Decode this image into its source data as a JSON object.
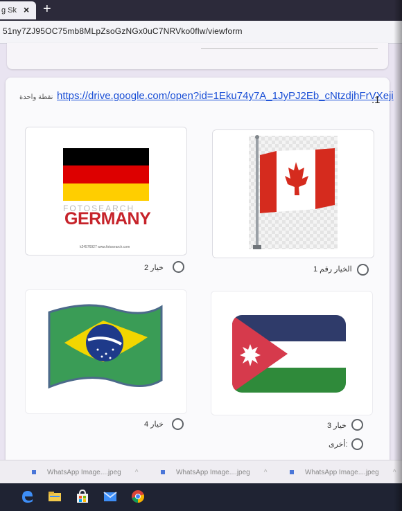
{
  "browser": {
    "tab_title": "g Sk",
    "tab_close": "×",
    "new_tab": "+",
    "url": "51ny7ZJ95OC75mb8MLpZsoGzNGx0uC7NRVko0flw/viewform"
  },
  "question": {
    "number": ".1",
    "link_text": "https://drive.google.com/open?id=1Eku74y7A_1JyPJ2Eb_cNtzdjhFrVXeji",
    "points": "نقطة واحدة"
  },
  "options": [
    {
      "label": "الخيار رقم 1",
      "image": "canada-flag"
    },
    {
      "label": "خيار 2",
      "image": "germany-flag"
    },
    {
      "label": "خيار 3",
      "image": "jordan-flag"
    },
    {
      "label": "خيار 4",
      "image": "brazil-flag"
    },
    {
      "label": "أخرى:",
      "image": ""
    }
  ],
  "germany_image": {
    "brand": "FOTOSEARCH",
    "word": "GERMANY",
    "credit": "k24576927 www.fotosearch.com"
  },
  "downloads": [
    {
      "name": "WhatsApp Image....jpeg"
    },
    {
      "name": "WhatsApp Image....jpeg"
    },
    {
      "name": "WhatsApp Image....jpeg"
    }
  ],
  "taskbar_icons": [
    "edge-icon",
    "file-explorer-icon",
    "store-icon",
    "mail-icon",
    "chrome-icon"
  ],
  "colors": {
    "link": "#1a4fd6",
    "canada_red": "#d52b1e",
    "germany_black": "#000000",
    "germany_red": "#dd0000",
    "germany_gold": "#ffce00",
    "brazil_green": "#3a9c56",
    "brazil_yellow": "#f2d600",
    "brazil_blue": "#1e3a8a",
    "jordan_black": "#2f3b6a",
    "jordan_green": "#2f8a3a",
    "jordan_red": "#d63a4c"
  }
}
